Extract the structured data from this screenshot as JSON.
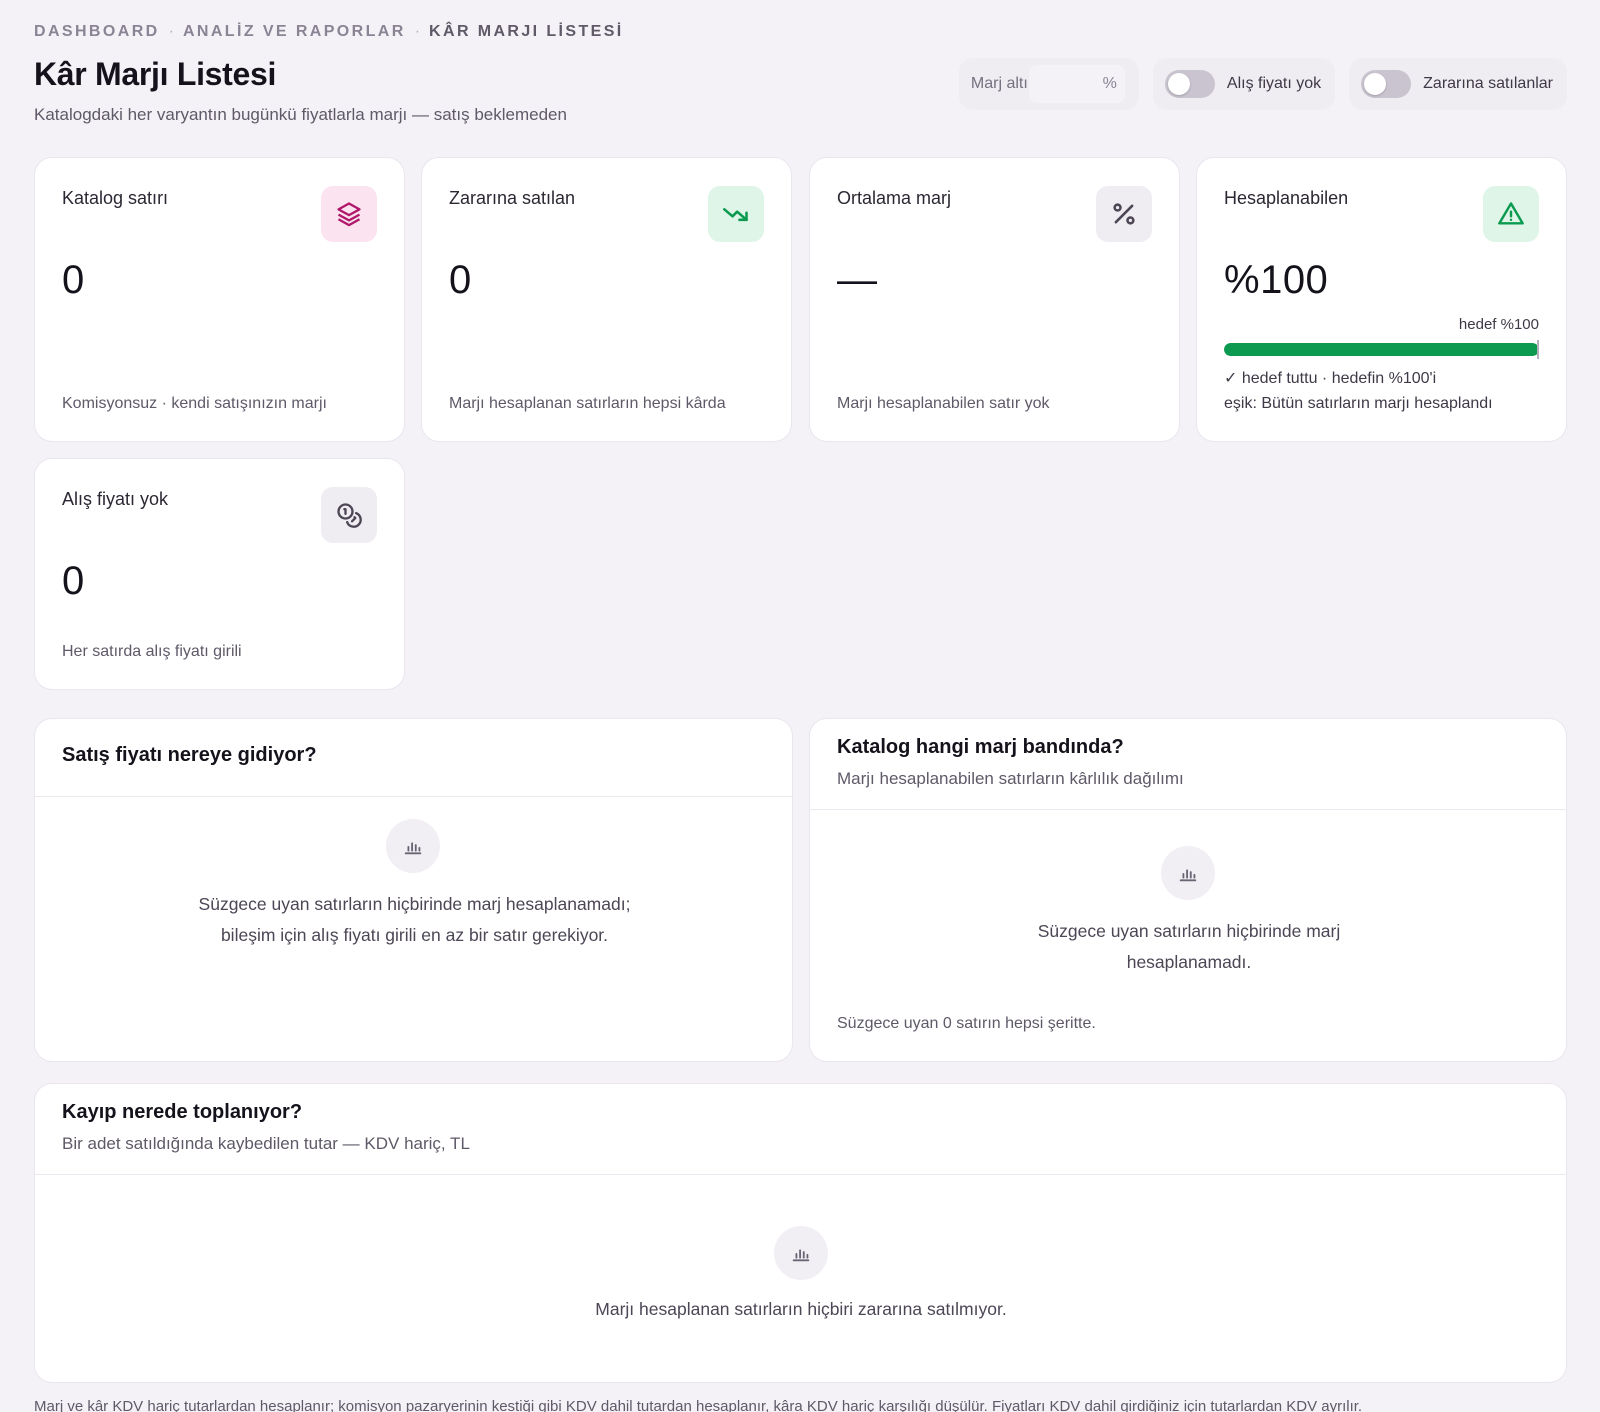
{
  "breadcrumb": {
    "items": [
      "DASHBOARD",
      "ANALİZ VE RAPORLAR",
      "KÂR MARJI LİSTESİ"
    ],
    "separator": "·"
  },
  "header": {
    "title": "Kâr Marjı Listesi",
    "subtitle": "Katalogdaki her varyantın bugünkü fiyatlarla marjı — satış beklemeden"
  },
  "filters": {
    "margin_label": "Marj altı",
    "margin_value": "",
    "margin_unit": "%",
    "no_cost_label": "Alış fiyatı yok",
    "no_cost_on": false,
    "loss_label": "Zararına satılanlar",
    "loss_on": false
  },
  "kpis": {
    "catalog": {
      "label": "Katalog satırı",
      "value": "0",
      "note": "Komisyonsuz · kendi satışınızın marjı",
      "icon": "layers-icon",
      "icon_bg": "#fbe4ef",
      "icon_color": "#b0176a"
    },
    "loss": {
      "label": "Zararına satılan",
      "value": "0",
      "note": "Marjı hesaplanan satırların hepsi kârda",
      "icon": "trending-down-icon",
      "icon_bg": "#def5e8",
      "icon_color": "#0b9a4f"
    },
    "avg": {
      "label": "Ortalama marj",
      "value": "—",
      "note": "Marjı hesaplanabilen satır yok",
      "icon": "percent-icon",
      "icon_bg": "#efedf2",
      "icon_color": "#4c4655"
    },
    "computable": {
      "label": "Hesaplanabilen",
      "value": "%100",
      "target_label": "hedef %100",
      "progress_percent": 100,
      "status": "✓ hedef tuttu · hedefin %100'i",
      "threshold": "eşik: Bütün satırların marjı hesaplandı",
      "icon": "alert-triangle-icon",
      "icon_bg": "#def5e8",
      "icon_color": "#0b9a4f"
    },
    "no_cost": {
      "label": "Alış fiyatı yok",
      "value": "0",
      "note": "Her satırda alış fiyatı girili",
      "icon": "coins-icon",
      "icon_bg": "#efedf2",
      "icon_color": "#4c4655"
    }
  },
  "panels": {
    "price": {
      "title": "Satış fiyatı nereye gidiyor?",
      "empty": "Süzgece uyan satırların hiçbirinde marj hesaplanamadı; bileşim için alış fiyatı girili en az bir satır gerekiyor."
    },
    "band": {
      "title": "Katalog hangi marj bandında?",
      "subtitle": "Marjı hesaplanabilen satırların kârlılık dağılımı",
      "empty": "Süzgece uyan satırların hiçbirinde marj hesaplanamadı.",
      "footnote": "Süzgece uyan 0 satırın hepsi şeritte."
    },
    "loss": {
      "title": "Kayıp nerede toplanıyor?",
      "subtitle": "Bir adet satıldığında kaybedilen tutar — KDV hariç, TL",
      "empty": "Marjı hesaplanan satırların hiçbiri zararına satılmıyor."
    }
  },
  "footer_note": "Marj ve kâr KDV hariç tutarlardan hesaplanır; komisyon pazaryerinin kestiği gibi KDV dahil tutardan hesaplanır, kâra KDV hariç karşılığı düşülür. Fiyatları KDV dahil girdiğiniz için tutarlardan KDV ayrılır."
}
